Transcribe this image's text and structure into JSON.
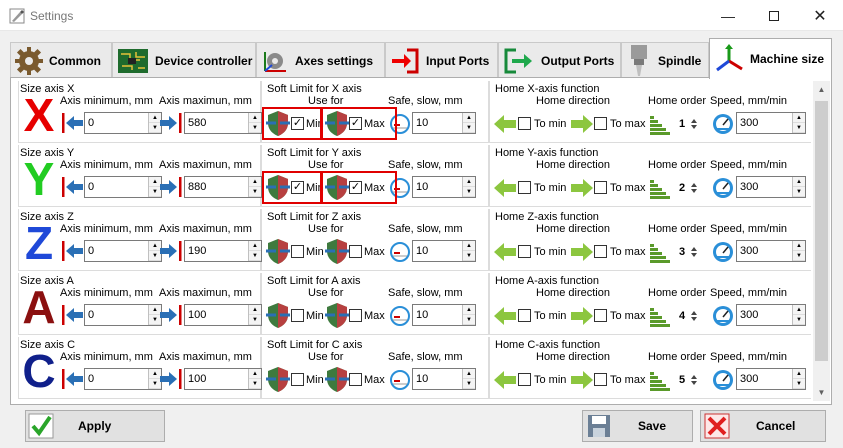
{
  "window": {
    "title": "Settings",
    "minimize_icon": "minimize-icon",
    "maximize_icon": "maximize-icon",
    "close_icon": "close-icon"
  },
  "tabs": [
    {
      "label": "Common",
      "icon": "gear-icon"
    },
    {
      "label": "Device controller",
      "icon": "circuit-board-icon"
    },
    {
      "label": "Axes settings",
      "icon": "axes-gear-icon"
    },
    {
      "label": "Input Ports",
      "icon": "input-arrow-icon"
    },
    {
      "label": "Output Ports",
      "icon": "output-arrow-icon"
    },
    {
      "label": "Spindle",
      "icon": "spindle-icon"
    },
    {
      "label": "Machine size",
      "icon": "xyz-axes-icon",
      "active": true
    }
  ],
  "headers": {
    "axis_min": "Axis minimum, mm",
    "axis_max": "Axis maximun, mm",
    "use_for": "Use for",
    "safe_slow": "Safe, slow, mm",
    "home_direction": "Home direction",
    "home_order": "Home order",
    "speed": "Speed, mm/min",
    "min_label": "Min",
    "max_label": "Max",
    "to_min": "To min",
    "to_max": "To max"
  },
  "axes": [
    {
      "letter": "X",
      "color": "#e60000",
      "size_title": "Size axis X",
      "min": "0",
      "max": "580",
      "soft_title": "Soft Limit for X axis",
      "soft_min": true,
      "soft_max": true,
      "safe": "10",
      "home_title": "Home X-axis function",
      "to_min": false,
      "to_max": false,
      "order": "1",
      "speed": "300",
      "highlight": true
    },
    {
      "letter": "Y",
      "color": "#22cc22",
      "size_title": "Size axis Y",
      "min": "0",
      "max": "880",
      "soft_title": "Soft Limit for Y axis",
      "soft_min": true,
      "soft_max": true,
      "safe": "10",
      "home_title": "Home Y-axis function",
      "to_min": false,
      "to_max": false,
      "order": "2",
      "speed": "300",
      "highlight": true
    },
    {
      "letter": "Z",
      "color": "#1f49d8",
      "size_title": "Size axis Z",
      "min": "0",
      "max": "190",
      "soft_title": "Soft Limit for Z axis",
      "soft_min": false,
      "soft_max": false,
      "safe": "10",
      "home_title": "Home Z-axis function",
      "to_min": false,
      "to_max": false,
      "order": "3",
      "speed": "300",
      "highlight": false
    },
    {
      "letter": "A",
      "color": "#8b1010",
      "size_title": "Size axis A",
      "min": "0",
      "max": "100",
      "soft_title": "Soft Limit for A axis",
      "soft_min": false,
      "soft_max": false,
      "safe": "10",
      "home_title": "Home A-axis function",
      "to_min": false,
      "to_max": false,
      "order": "4",
      "speed": "300",
      "highlight": false
    },
    {
      "letter": "C",
      "color": "#10208b",
      "size_title": "Size axis C",
      "min": "0",
      "max": "100",
      "soft_title": "Soft Limit for C axis",
      "soft_min": false,
      "soft_max": false,
      "safe": "10",
      "home_title": "Home C-axis function",
      "to_min": false,
      "to_max": false,
      "order": "5",
      "speed": "300",
      "highlight": false
    }
  ],
  "buttons": {
    "apply": "Apply",
    "save": "Save",
    "cancel": "Cancel"
  }
}
